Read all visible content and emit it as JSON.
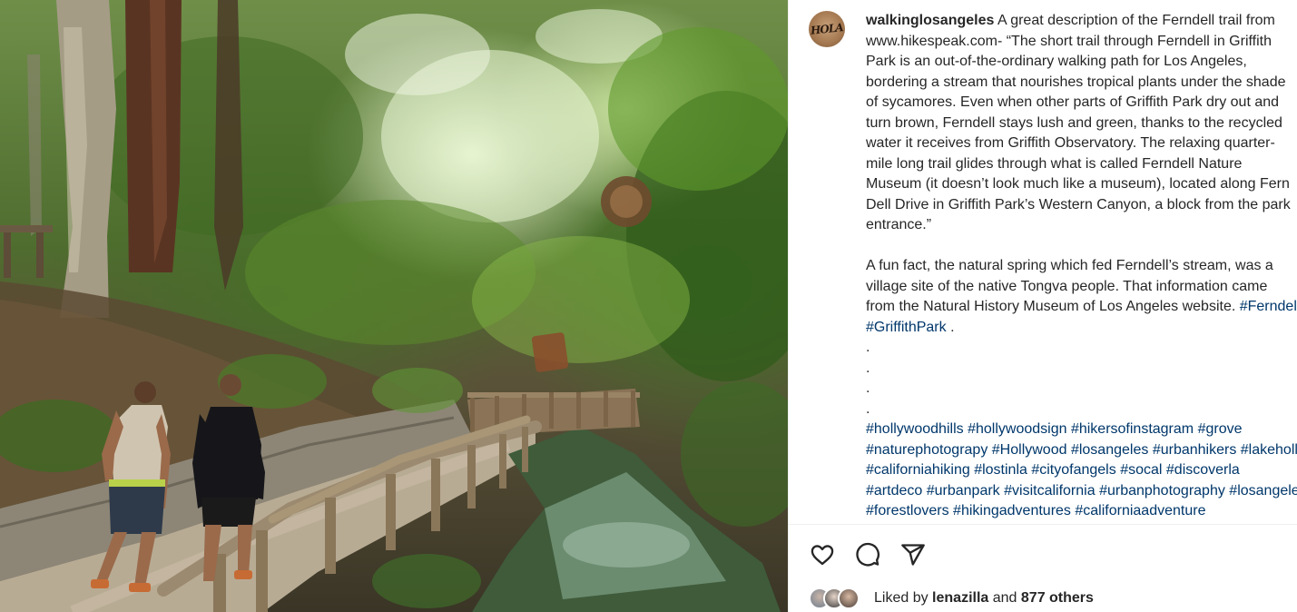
{
  "photo": {
    "alt_icon": "forest-trail-photo"
  },
  "post": {
    "avatar_text": "HOLA",
    "username": "walkinglosangeles",
    "caption_lines": [
      " A great description of the Ferndell trail from",
      "www.hikespeak.com- “The short trail through Ferndell in Griffith",
      "Park is an out-of-the-ordinary walking path for Los Angeles,",
      "bordering a stream that nourishes tropical plants under the shade",
      "of sycamores. Even when other parts of Griffith Park dry out and",
      "turn brown, Ferndell stays lush and green, thanks to the recycled",
      "water it receives from Griffith Observatory. The relaxing quarter-",
      "mile long trail glides through what is called Ferndell Nature",
      "Museum (it doesn’t look much like a museum), located along Fern",
      "Dell Drive in Griffith Park’s Western Canyon, a block from the park",
      "entrance.”"
    ],
    "fact_lines": [
      "A fun fact, the natural spring which fed Ferndell’s stream, was a",
      "village site of the native Tongva people. That information came",
      "from the Natural History Museum of Los Angeles website. "
    ],
    "fact_tag_1": "#Ferndell",
    "fact_tag_2": "#GriffithPark",
    "fact_end": " .",
    "dots": [
      ".",
      ".",
      ".",
      "."
    ],
    "hashtag_lines": [
      [
        "#hollywoodhills",
        "#hollywoodsign",
        "#hikersofinstagram",
        "#grove"
      ],
      [
        "#naturephotograpy",
        "#Hollywood",
        "#losangeles",
        "#urbanhikers",
        "#lakehollywood"
      ],
      [
        "#californiahiking",
        "#lostinla",
        "#cityofangels",
        "#socal",
        "#discoverla"
      ],
      [
        "#artdeco",
        "#urbanpark",
        "#visitcalifornia",
        "#urbanphotography",
        "#losangelesphotography"
      ],
      [
        "#forestlovers",
        "#hikingadventures",
        "#californiaadventure"
      ]
    ]
  },
  "actions": {
    "like_icon": "heart-icon",
    "comment_icon": "comment-icon",
    "share_icon": "share-icon"
  },
  "likes": {
    "prefix": "Liked by ",
    "user": "lenazilla",
    "middle": " and ",
    "others": "877 others"
  }
}
